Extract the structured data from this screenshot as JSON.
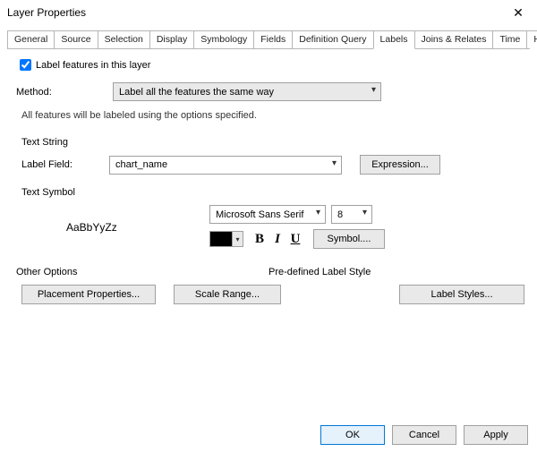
{
  "window": {
    "title": "Layer Properties",
    "close_glyph": "✕"
  },
  "tabs": {
    "general": "General",
    "source": "Source",
    "selection": "Selection",
    "display": "Display",
    "symbology": "Symbology",
    "fields": "Fields",
    "defq": "Definition Query",
    "labels": "Labels",
    "joins": "Joins & Relates",
    "time": "Time",
    "html": "HTML Popup"
  },
  "labels": {
    "enable_label": "Label features in this layer",
    "enable_checked": true,
    "method_label": "Method:",
    "method_value": "Label all the features the same way",
    "desc": "All features will be labeled using the options specified.",
    "text_string_title": "Text String",
    "label_field_label": "Label Field:",
    "label_field_value": "chart_name",
    "expression_btn": "Expression...",
    "text_symbol_title": "Text Symbol",
    "sample_text": "AaBbYyZz",
    "font_value": "Microsoft Sans Serif",
    "size_value": "8",
    "bold_glyph": "B",
    "italic_glyph": "I",
    "underline_glyph": "U",
    "symbol_btn": "Symbol....",
    "other_options_title": "Other Options",
    "predefined_title": "Pre-defined Label Style",
    "placement_btn": "Placement Properties...",
    "scale_btn": "Scale Range...",
    "label_styles_btn": "Label Styles..."
  },
  "buttons": {
    "ok": "OK",
    "cancel": "Cancel",
    "apply": "Apply"
  }
}
